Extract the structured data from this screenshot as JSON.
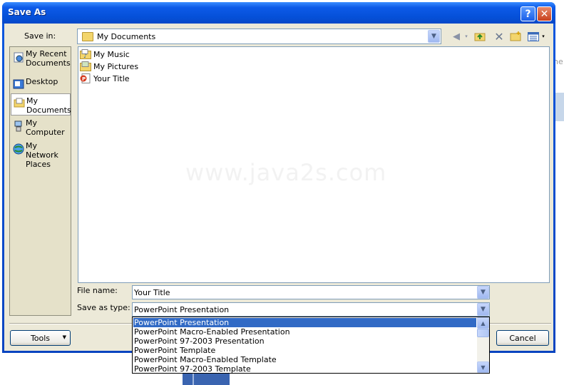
{
  "dialog": {
    "title": "Save As",
    "help_glyph": "?",
    "close_glyph": "✕"
  },
  "save_in": {
    "label": "Save in:",
    "value": "My Documents"
  },
  "toolbar": {
    "icons": [
      "back-icon",
      "up-folder-icon",
      "delete-icon",
      "new-folder-icon",
      "views-icon"
    ]
  },
  "places": [
    {
      "label": "My Recent Documents",
      "icon": "recent-documents-icon"
    },
    {
      "label": "Desktop",
      "icon": "desktop-icon"
    },
    {
      "label": "My Documents",
      "icon": "my-documents-icon"
    },
    {
      "label": "My Computer",
      "icon": "my-computer-icon"
    },
    {
      "label": "My Network Places",
      "icon": "network-places-icon"
    }
  ],
  "files": [
    {
      "name": "My Music",
      "icon": "music-folder-icon"
    },
    {
      "name": "My Pictures",
      "icon": "pictures-folder-icon"
    },
    {
      "name": "Your Title",
      "icon": "powerpoint-file-icon"
    }
  ],
  "watermark": "www.java2s.com",
  "file_name": {
    "label": "File name:",
    "value": "Your Title"
  },
  "save_as_type": {
    "label": "Save as type:",
    "value": "PowerPoint Presentation",
    "options": [
      "PowerPoint Presentation",
      "PowerPoint Macro-Enabled Presentation",
      "PowerPoint 97-2003 Presentation",
      "PowerPoint Template",
      "PowerPoint Macro-Enabled Template",
      "PowerPoint 97-2003 Template"
    ],
    "selected_index": 0
  },
  "buttons": {
    "tools": "Tools",
    "cancel": "Cancel"
  },
  "background": {
    "partial_text": "ne"
  },
  "colors": {
    "titlebar": "#0550d8",
    "selection": "#316ac5",
    "dialog_face": "#ece9d8"
  }
}
